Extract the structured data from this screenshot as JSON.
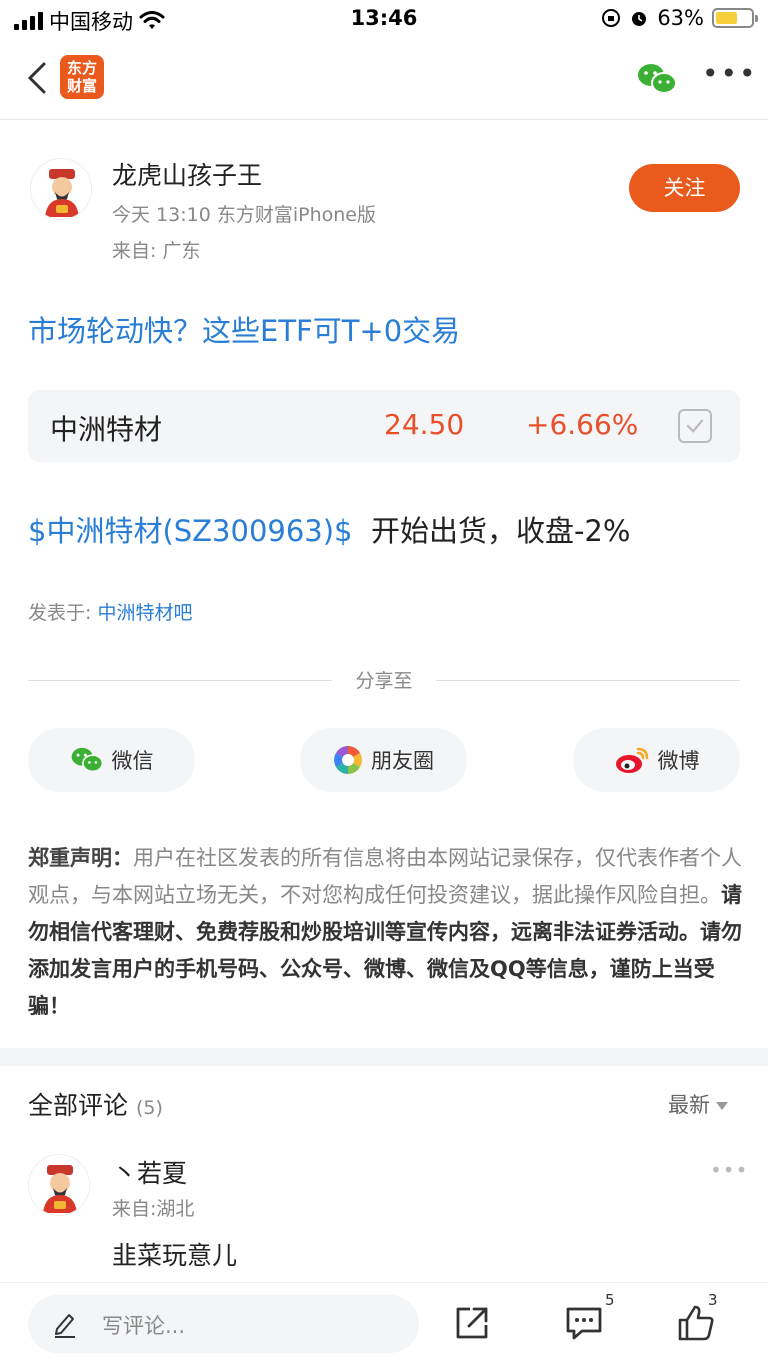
{
  "status_bar": {
    "carrier": "中国移动",
    "time": "13:46",
    "battery": "63%",
    "battery_level": 0.63
  },
  "nav": {
    "logo_line1": "东方",
    "logo_line2": "财富",
    "icons": [
      "back-icon",
      "wechat-icon",
      "more-icon"
    ]
  },
  "author": {
    "name": "龙虎山孩子王",
    "meta": "今天 13:10 东方财富iPhone版",
    "location": "来自: 广东",
    "follow_label": "关注"
  },
  "post": {
    "title": "市场轮动快？这些ETF可T+0交易",
    "stock": {
      "name": "中洲特材",
      "price": "24.50",
      "change": "+6.66%"
    },
    "body_tag": "$中洲特材(SZ300963)$",
    "body_text": "  开始出货，收盘-2%",
    "posted_in_label": "发表于: ",
    "posted_in_bar": "中洲特材吧"
  },
  "share": {
    "label": "分享至",
    "wechat": "微信",
    "moments": "朋友圈",
    "weibo": "微博"
  },
  "disclaimer": {
    "lead": "郑重声明：",
    "normal": "用户在社区发表的所有信息将由本网站记录保存，仅代表作者个人观点，与本网站立场无关，不对您构成任何投资建议，据此操作风险自担。",
    "strong": "请勿相信代客理财、免费荐股和炒股培训等宣传内容，远离非法证券活动。请勿添加发言用户的手机号码、公众号、微博、微信及QQ等信息，谨防上当受骗！"
  },
  "comments": {
    "title": "全部评论",
    "count": "(5)",
    "sort": "最新",
    "items": [
      {
        "name": "丶若夏",
        "location": "来自:湖北",
        "text": "韭菜玩意儿"
      }
    ]
  },
  "bottom_bar": {
    "placeholder": "写评论...",
    "comment_count": "5",
    "like_count": "3"
  },
  "colors": {
    "brand": "#ea5a1c",
    "link": "#2a7ed6",
    "up": "#e8502a"
  }
}
